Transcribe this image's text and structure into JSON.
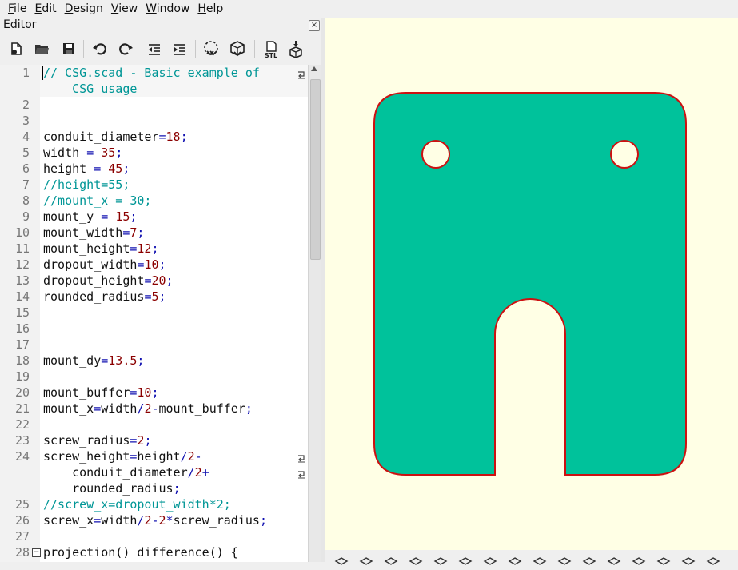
{
  "menu": [
    {
      "label": "File",
      "mnemonic": "F",
      "rest": "ile"
    },
    {
      "label": "Edit",
      "mnemonic": "E",
      "rest": "dit"
    },
    {
      "label": "Design",
      "mnemonic": "D",
      "rest": "esign"
    },
    {
      "label": "View",
      "mnemonic": "V",
      "rest": "iew"
    },
    {
      "label": "Window",
      "mnemonic": "W",
      "rest": "indow"
    },
    {
      "label": "Help",
      "mnemonic": "H",
      "rest": "elp"
    }
  ],
  "editor": {
    "title": "Editor",
    "close_glyph": "×",
    "toolbar_icons": [
      "new-file-icon",
      "open-folder-icon",
      "save-icon",
      "undo-icon",
      "redo-icon",
      "unindent-icon",
      "indent-icon",
      "preview-icon",
      "render-icon",
      "export-stl-icon",
      "send-to-print-icon"
    ],
    "stl_label": "STL",
    "lines": [
      {
        "n": "1",
        "wrapped": true,
        "segs": [
          [
            "c",
            "// CSG.scad - Basic example of"
          ]
        ],
        "cont": [
          [
            [
              "c",
              "    CSG usage"
            ]
          ]
        ]
      },
      {
        "n": "2",
        "segs": []
      },
      {
        "n": "3",
        "segs": []
      },
      {
        "n": "4",
        "segs": [
          [
            "t",
            "conduit_diameter"
          ],
          [
            "o",
            "="
          ],
          [
            "n",
            "18"
          ],
          [
            "o",
            ";"
          ]
        ]
      },
      {
        "n": "5",
        "segs": [
          [
            "t",
            "width "
          ],
          [
            "o",
            "="
          ],
          [
            "t",
            " "
          ],
          [
            "n",
            "35"
          ],
          [
            "o",
            ";"
          ]
        ]
      },
      {
        "n": "6",
        "segs": [
          [
            "t",
            "height "
          ],
          [
            "o",
            "="
          ],
          [
            "t",
            " "
          ],
          [
            "n",
            "45"
          ],
          [
            "o",
            ";"
          ]
        ]
      },
      {
        "n": "7",
        "segs": [
          [
            "c",
            "//height=55;"
          ]
        ]
      },
      {
        "n": "8",
        "segs": [
          [
            "c",
            "//mount_x = 30;"
          ]
        ]
      },
      {
        "n": "9",
        "segs": [
          [
            "t",
            "mount_y "
          ],
          [
            "o",
            "="
          ],
          [
            "t",
            " "
          ],
          [
            "n",
            "15"
          ],
          [
            "o",
            ";"
          ]
        ]
      },
      {
        "n": "10",
        "segs": [
          [
            "t",
            "mount_width"
          ],
          [
            "o",
            "="
          ],
          [
            "n",
            "7"
          ],
          [
            "o",
            ";"
          ]
        ]
      },
      {
        "n": "11",
        "segs": [
          [
            "t",
            "mount_height"
          ],
          [
            "o",
            "="
          ],
          [
            "n",
            "12"
          ],
          [
            "o",
            ";"
          ]
        ]
      },
      {
        "n": "12",
        "segs": [
          [
            "t",
            "dropout_width"
          ],
          [
            "o",
            "="
          ],
          [
            "n",
            "10"
          ],
          [
            "o",
            ";"
          ]
        ]
      },
      {
        "n": "13",
        "segs": [
          [
            "t",
            "dropout_height"
          ],
          [
            "o",
            "="
          ],
          [
            "n",
            "20"
          ],
          [
            "o",
            ";"
          ]
        ]
      },
      {
        "n": "14",
        "segs": [
          [
            "t",
            "rounded_radius"
          ],
          [
            "o",
            "="
          ],
          [
            "n",
            "5"
          ],
          [
            "o",
            ";"
          ]
        ]
      },
      {
        "n": "15",
        "segs": []
      },
      {
        "n": "16",
        "segs": []
      },
      {
        "n": "17",
        "segs": []
      },
      {
        "n": "18",
        "segs": [
          [
            "t",
            "mount_dy"
          ],
          [
            "o",
            "="
          ],
          [
            "n",
            "13.5"
          ],
          [
            "o",
            ";"
          ]
        ]
      },
      {
        "n": "19",
        "segs": []
      },
      {
        "n": "20",
        "segs": [
          [
            "t",
            "mount_buffer"
          ],
          [
            "o",
            "="
          ],
          [
            "n",
            "10"
          ],
          [
            "o",
            ";"
          ]
        ]
      },
      {
        "n": "21",
        "segs": [
          [
            "t",
            "mount_x"
          ],
          [
            "o",
            "="
          ],
          [
            "t",
            "width"
          ],
          [
            "o",
            "/"
          ],
          [
            "n",
            "2"
          ],
          [
            "o",
            "-"
          ],
          [
            "t",
            "mount_buffer"
          ],
          [
            "o",
            ";"
          ]
        ]
      },
      {
        "n": "22",
        "segs": []
      },
      {
        "n": "23",
        "segs": [
          [
            "t",
            "screw_radius"
          ],
          [
            "o",
            "="
          ],
          [
            "n",
            "2"
          ],
          [
            "o",
            ";"
          ]
        ]
      },
      {
        "n": "24",
        "wrapped": true,
        "segs": [
          [
            "t",
            "screw_height"
          ],
          [
            "o",
            "="
          ],
          [
            "t",
            "height"
          ],
          [
            "o",
            "/"
          ],
          [
            "n",
            "2"
          ],
          [
            "o",
            "-"
          ]
        ],
        "cont": [
          [
            [
              "t",
              "    conduit_diameter"
            ],
            [
              "o",
              "/"
            ],
            [
              "n",
              "2"
            ],
            [
              "o",
              "+"
            ]
          ],
          [
            [
              "t",
              "    rounded_radius"
            ],
            [
              "o",
              ";"
            ]
          ]
        ]
      },
      {
        "n": "25",
        "segs": [
          [
            "c",
            "//screw_x=dropout_width*2;"
          ]
        ]
      },
      {
        "n": "26",
        "segs": [
          [
            "t",
            "screw_x"
          ],
          [
            "o",
            "="
          ],
          [
            "t",
            "width"
          ],
          [
            "o",
            "/"
          ],
          [
            "n",
            "2"
          ],
          [
            "o",
            "-"
          ],
          [
            "n",
            "2"
          ],
          [
            "o",
            "*"
          ],
          [
            "t",
            "screw_radius"
          ],
          [
            "o",
            ";"
          ]
        ]
      },
      {
        "n": "27",
        "segs": []
      },
      {
        "n": "28",
        "fold": true,
        "segs": [
          [
            "t",
            "projection() difference() {"
          ]
        ]
      }
    ]
  },
  "viewport": {
    "background": "#ffffe5",
    "shape_fill": "#00c29b",
    "shape_stroke": "#cc1111"
  },
  "view_toolbar_icons": [
    "preview-icon",
    "render-icon",
    "view-all-icon",
    "zoom-in-icon",
    "zoom-out-icon",
    "reset-view-icon",
    "perspective-icon",
    "orthogonal-icon",
    "view-top-icon",
    "view-bottom-icon",
    "view-left-icon",
    "view-right-icon",
    "view-front-icon",
    "view-back-icon",
    "show-axes-icon",
    "show-edges-icon"
  ]
}
